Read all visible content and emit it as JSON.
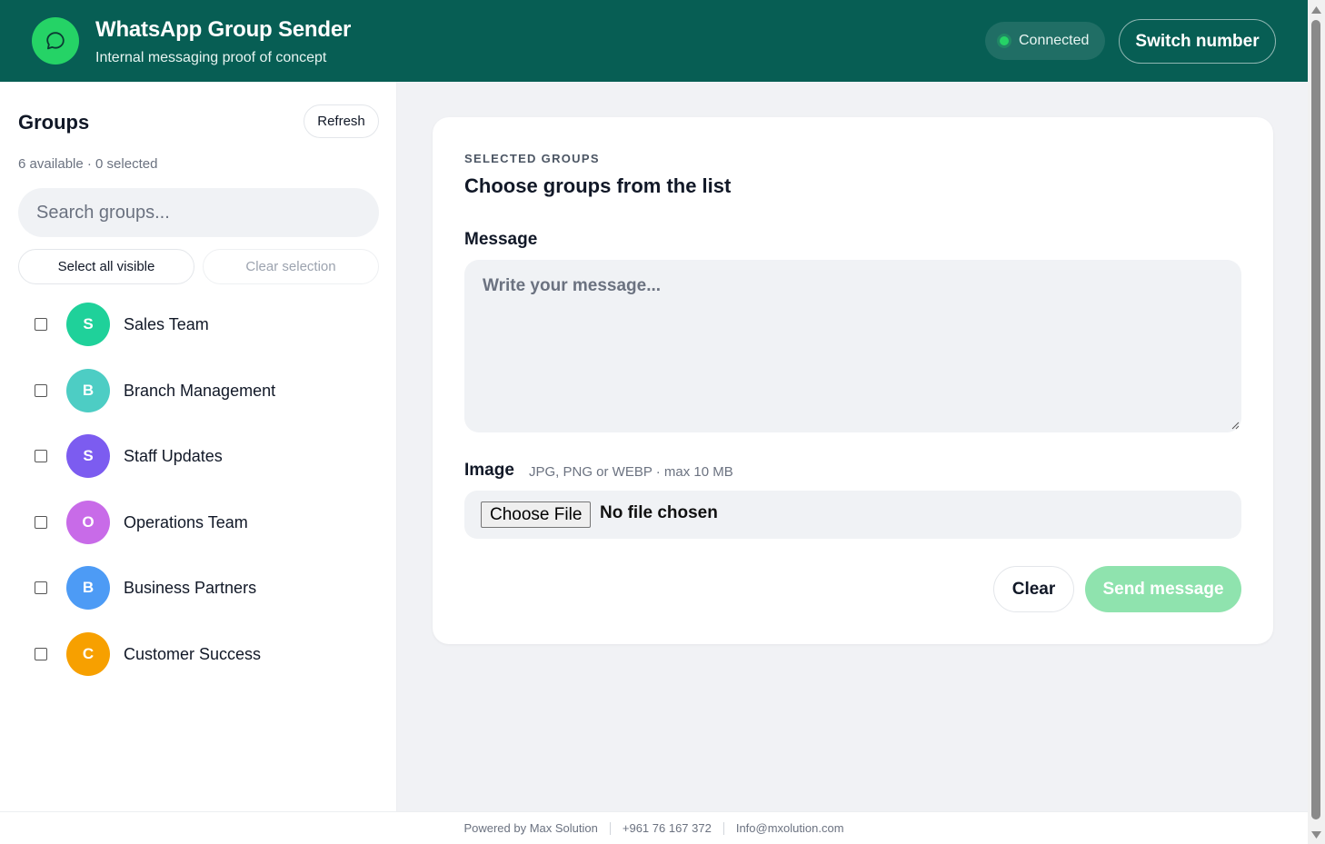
{
  "header": {
    "title": "WhatsApp Group Sender",
    "subtitle": "Internal messaging proof of concept",
    "status": "Connected",
    "switch_label": "Switch number",
    "logo_icon": "chat-bubble-icon"
  },
  "sidebar": {
    "title": "Groups",
    "refresh_label": "Refresh",
    "count_text": "6 available · 0 selected",
    "search_placeholder": "Search groups...",
    "select_all_label": "Select all visible",
    "clear_selection_label": "Clear selection",
    "groups": [
      {
        "initial": "S",
        "name": "Sales Team",
        "color": "#1fd19a",
        "checked": false
      },
      {
        "initial": "B",
        "name": "Branch Management",
        "color": "#4dcdc4",
        "checked": false
      },
      {
        "initial": "S",
        "name": "Staff Updates",
        "color": "#7c5cf0",
        "checked": false
      },
      {
        "initial": "O",
        "name": "Operations Team",
        "color": "#c86be8",
        "checked": false
      },
      {
        "initial": "B",
        "name": "Business Partners",
        "color": "#4d9bf5",
        "checked": false
      },
      {
        "initial": "C",
        "name": "Customer Success",
        "color": "#f7a000",
        "checked": false
      }
    ]
  },
  "composer": {
    "eyebrow": "SELECTED GROUPS",
    "heading": "Choose groups from the list",
    "message_label": "Message",
    "message_placeholder": "Write your message...",
    "message_value": "",
    "image_label": "Image",
    "image_hint": "JPG, PNG or WEBP · max 10 MB",
    "choose_file_label": "Choose File",
    "file_status": "No file chosen",
    "clear_label": "Clear",
    "send_label": "Send message"
  },
  "footer": {
    "powered_by": "Powered by Max Solution",
    "phone": "+961 76 167 372",
    "email": "Info@mxolution.com"
  },
  "colors": {
    "header_bg": "#075e54",
    "accent": "#25d366",
    "send_disabled": "#8fe3ae"
  }
}
